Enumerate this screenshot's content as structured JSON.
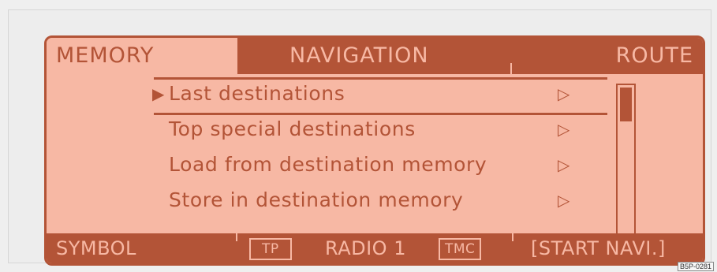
{
  "tabs": {
    "memory": "MEMORY",
    "navigation": "NAVIGATION",
    "route": "ROUTE"
  },
  "menu": {
    "items": [
      {
        "label": "Last destinations",
        "selected": true,
        "indicator": "▷"
      },
      {
        "label": "Top special destinations",
        "selected": false,
        "indicator": "▷"
      },
      {
        "label": "Load from destination memory",
        "selected": false,
        "indicator": "▷"
      },
      {
        "label": "Store in destination memory",
        "selected": false,
        "indicator": "▷"
      }
    ],
    "pointer": "▶"
  },
  "bottom": {
    "symbol": "SYMBOL",
    "tp": "TP",
    "radio": "RADIO 1",
    "tmc": "TMC",
    "start": "[START NAVI.]"
  },
  "colors": {
    "screen_bg": "#f7b8a4",
    "accent": "#b35437"
  },
  "ref_code": "B5P-0281"
}
